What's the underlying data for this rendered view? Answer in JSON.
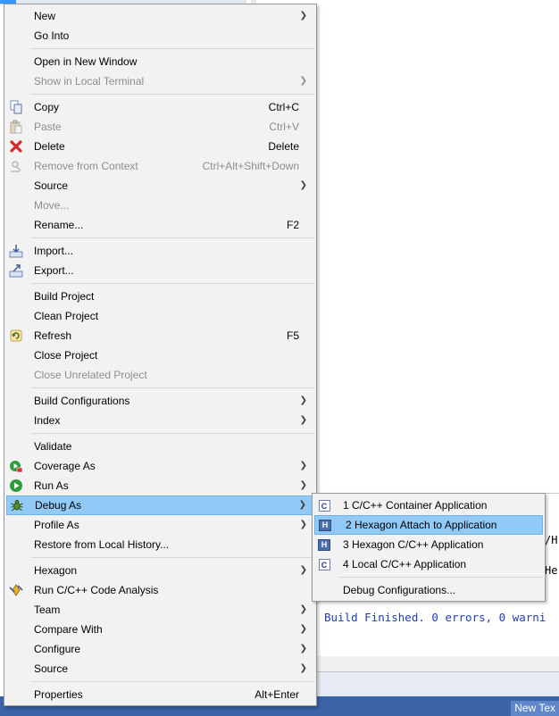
{
  "main_menu": {
    "groups": [
      [
        {
          "label": "New",
          "shortcut": "",
          "submenu": true,
          "disabled": false,
          "icon": ""
        },
        {
          "label": "Go Into",
          "shortcut": "",
          "submenu": false,
          "disabled": false,
          "icon": ""
        }
      ],
      [
        {
          "label": "Open in New Window",
          "shortcut": "",
          "submenu": false,
          "disabled": false,
          "icon": ""
        },
        {
          "label": "Show in Local Terminal",
          "shortcut": "",
          "submenu": true,
          "disabled": true,
          "icon": ""
        }
      ],
      [
        {
          "label": "Copy",
          "shortcut": "Ctrl+C",
          "submenu": false,
          "disabled": false,
          "icon": "copy-icon"
        },
        {
          "label": "Paste",
          "shortcut": "Ctrl+V",
          "submenu": false,
          "disabled": true,
          "icon": "paste-icon"
        },
        {
          "label": "Delete",
          "shortcut": "Delete",
          "submenu": false,
          "disabled": false,
          "icon": "delete-icon"
        },
        {
          "label": "Remove from Context",
          "shortcut": "Ctrl+Alt+Shift+Down",
          "submenu": false,
          "disabled": true,
          "icon": "remove-context-icon"
        },
        {
          "label": "Source",
          "shortcut": "",
          "submenu": true,
          "disabled": false,
          "icon": ""
        },
        {
          "label": "Move...",
          "shortcut": "",
          "submenu": false,
          "disabled": true,
          "icon": ""
        },
        {
          "label": "Rename...",
          "shortcut": "F2",
          "submenu": false,
          "disabled": false,
          "icon": ""
        }
      ],
      [
        {
          "label": "Import...",
          "shortcut": "",
          "submenu": false,
          "disabled": false,
          "icon": "import-icon"
        },
        {
          "label": "Export...",
          "shortcut": "",
          "submenu": false,
          "disabled": false,
          "icon": "export-icon"
        }
      ],
      [
        {
          "label": "Build Project",
          "shortcut": "",
          "submenu": false,
          "disabled": false,
          "icon": ""
        },
        {
          "label": "Clean Project",
          "shortcut": "",
          "submenu": false,
          "disabled": false,
          "icon": ""
        },
        {
          "label": "Refresh",
          "shortcut": "F5",
          "submenu": false,
          "disabled": false,
          "icon": "refresh-icon"
        },
        {
          "label": "Close Project",
          "shortcut": "",
          "submenu": false,
          "disabled": false,
          "icon": ""
        },
        {
          "label": "Close Unrelated Project",
          "shortcut": "",
          "submenu": false,
          "disabled": true,
          "icon": ""
        }
      ],
      [
        {
          "label": "Build Configurations",
          "shortcut": "",
          "submenu": true,
          "disabled": false,
          "icon": ""
        },
        {
          "label": "Index",
          "shortcut": "",
          "submenu": true,
          "disabled": false,
          "icon": ""
        }
      ],
      [
        {
          "label": "Validate",
          "shortcut": "",
          "submenu": false,
          "disabled": false,
          "icon": ""
        },
        {
          "label": "Coverage As",
          "shortcut": "",
          "submenu": true,
          "disabled": false,
          "icon": "coverage-icon"
        },
        {
          "label": "Run As",
          "shortcut": "",
          "submenu": true,
          "disabled": false,
          "icon": "run-icon"
        },
        {
          "label": "Debug As",
          "shortcut": "",
          "submenu": true,
          "disabled": false,
          "icon": "debug-icon",
          "highlighted": true
        },
        {
          "label": "Profile As",
          "shortcut": "",
          "submenu": true,
          "disabled": false,
          "icon": ""
        },
        {
          "label": "Restore from Local History...",
          "shortcut": "",
          "submenu": false,
          "disabled": false,
          "icon": ""
        }
      ],
      [
        {
          "label": "Hexagon",
          "shortcut": "",
          "submenu": true,
          "disabled": false,
          "icon": ""
        },
        {
          "label": "Run C/C++ Code Analysis",
          "shortcut": "",
          "submenu": false,
          "disabled": false,
          "icon": "code-analysis-icon"
        },
        {
          "label": "Team",
          "shortcut": "",
          "submenu": true,
          "disabled": false,
          "icon": ""
        },
        {
          "label": "Compare With",
          "shortcut": "",
          "submenu": true,
          "disabled": false,
          "icon": ""
        },
        {
          "label": "Configure",
          "shortcut": "",
          "submenu": true,
          "disabled": false,
          "icon": ""
        },
        {
          "label": "Source",
          "shortcut": "",
          "submenu": true,
          "disabled": false,
          "icon": ""
        }
      ],
      [
        {
          "label": "Properties",
          "shortcut": "Alt+Enter",
          "submenu": false,
          "disabled": false,
          "icon": ""
        }
      ]
    ]
  },
  "debug_submenu": {
    "items": [
      {
        "label": "1 C/C++ Container Application",
        "icon": "c-application-icon",
        "icon_text": "C"
      },
      {
        "label": "2 Hexagon Attach to Application",
        "icon": "hexagon-icon",
        "icon_text": "H",
        "highlighted": true
      },
      {
        "label": "3 Hexagon C/C++ Application",
        "icon": "hexagon-icon",
        "icon_text": "H"
      },
      {
        "label": "4 Local C/C++ Application",
        "icon": "c-application-icon",
        "icon_text": "C"
      }
    ],
    "footer_label": "Debug Configurations..."
  },
  "console": {
    "fragment_a": "/H",
    "fragment_b": "He",
    "build_status": "Build Finished. 0 errors, 0 warni"
  },
  "taskbar": {
    "item_label": "New Tex"
  },
  "colors": {
    "menu_bg": "#f2f2f2",
    "highlight_bg": "#91c9f7",
    "console_text": "#1f3fb0",
    "disabled_text": "#8d8d8d"
  }
}
